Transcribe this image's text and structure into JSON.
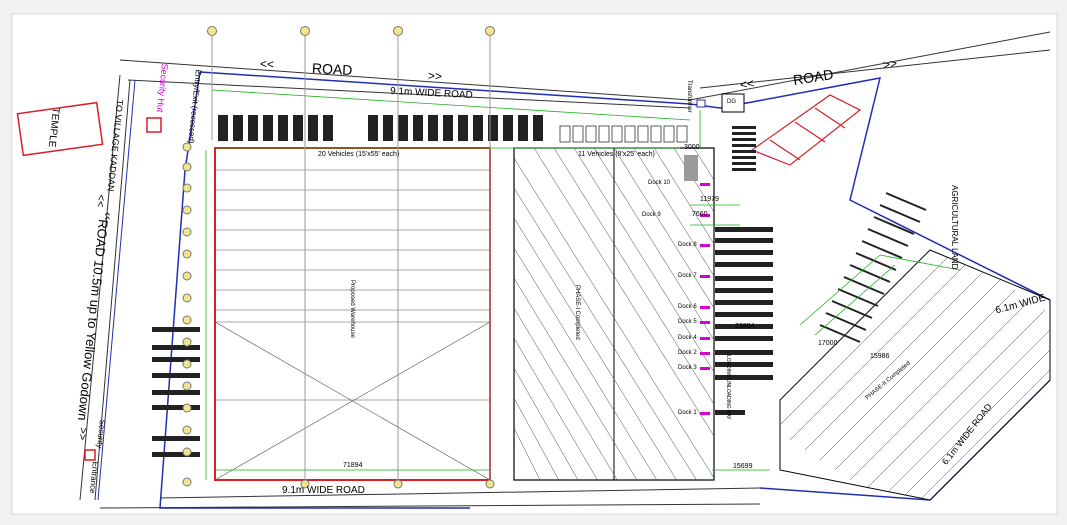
{
  "colors": {
    "page_bg": "#f2f1f0",
    "sheet_bg": "#ffffff",
    "boundary_blue": "#1f2fb5",
    "building_red": "#d81f26",
    "grid_green": "#17b317",
    "security_magenta": "#d400d4",
    "pole_yellow": "#f2e68c",
    "line_black": "#000000"
  },
  "roads": {
    "top_road": "ROAD",
    "top_road_arrows_left": "<<",
    "top_road_arrows_right": ">>",
    "top_road_right": "ROAD",
    "top_road_right_arrows_left": "<<",
    "top_road_right_arrows_right": ">>",
    "top_internal": "9.1m WIDE ROAD",
    "bottom_internal": "9.1m WIDE ROAD",
    "left_road": "ROAD 10.5m up to Yellow Godown",
    "left_arrows_top": "<<",
    "left_arrows_bottom": ">>",
    "to_village": "TO VILLAGE KADDAN",
    "right_road": "6.1m WIDE",
    "bottom_right_road": "6.1m WIDE ROAD"
  },
  "labels": {
    "temple": "TEMPLE",
    "entry_exit": "Entry/Exit (recessed)",
    "security_hut": "Security Hut",
    "security": "Security",
    "entrance": "Entrance",
    "transformer": "Transformer",
    "dg": "DG",
    "agricultural_land": "AGRICULTURAL LAND",
    "parking_20": "20 Vehicles (15'x55' each)",
    "parking_11": "11 Vehicles (8'x25' each)",
    "proposed_warehouse": "Proposed Warehouse",
    "phase_completed": "PHASE-I Completed",
    "phase_2": "PHASE-II Completed",
    "loading_bay": "LOADING UNLOADING BAY",
    "dock_10": "Dock 10",
    "dock_9": "Dock 9",
    "dock_8": "Dock 8",
    "dock_7": "Dock 7",
    "dock_6": "Dock 6",
    "dock_5": "Dock 5",
    "dock_4": "Dock 4",
    "dock_2": "Dock 2",
    "dock_3": "Dock 3",
    "dock_1": "Dock 1"
  },
  "dimensions": {
    "d_71894": "71894",
    "d_3000": "3000",
    "d_11979": "11979",
    "d_7660": "7660",
    "d_23894": "23894",
    "d_17000": "17000",
    "d_15699": "15699",
    "d_15986": "15986"
  }
}
